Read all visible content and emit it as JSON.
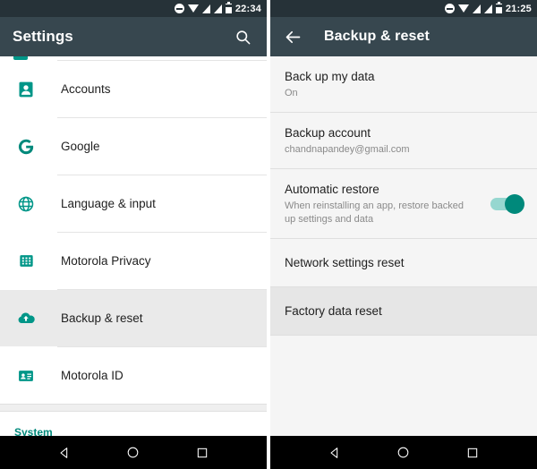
{
  "left_screen": {
    "status_bar": {
      "time": "22:34",
      "icons": [
        "do-not-disturb-icon",
        "wifi-icon",
        "signal-icon",
        "signal-icon",
        "battery-icon"
      ]
    },
    "toolbar": {
      "title": "Settings",
      "search_icon": "search-icon"
    },
    "list_items": [
      {
        "label": "Accounts",
        "icon": "account-icon",
        "selected": false
      },
      {
        "label": "Google",
        "icon": "google-g-icon",
        "selected": false
      },
      {
        "label": "Language & input",
        "icon": "globe-icon",
        "selected": false
      },
      {
        "label": "Motorola Privacy",
        "icon": "privacy-grid-icon",
        "selected": false
      },
      {
        "label": "Backup & reset",
        "icon": "cloud-upload-icon",
        "selected": true
      },
      {
        "label": "Motorola ID",
        "icon": "id-card-icon",
        "selected": false
      }
    ],
    "section_header": "System",
    "nav_bar": {
      "back": "back-triangle-icon",
      "home": "home-circle-icon",
      "recents": "recents-square-icon"
    }
  },
  "right_screen": {
    "status_bar": {
      "time": "21:25",
      "icons": [
        "do-not-disturb-icon",
        "wifi-icon",
        "signal-icon",
        "signal-icon",
        "battery-icon"
      ]
    },
    "toolbar": {
      "back_icon": "back-arrow-icon",
      "title": "Backup & reset"
    },
    "list_items": [
      {
        "title": "Back up my data",
        "subtitle": "On",
        "toggle": null,
        "selected": false
      },
      {
        "title": "Backup account",
        "subtitle": "chandnapandey@gmail.com",
        "toggle": null,
        "selected": false
      },
      {
        "title": "Automatic restore",
        "subtitle": "When reinstalling an app, restore backed up settings and data",
        "toggle": "on",
        "selected": false
      },
      {
        "title": "Network settings reset",
        "subtitle": "",
        "toggle": null,
        "selected": false
      },
      {
        "title": "Factory data reset",
        "subtitle": "",
        "toggle": null,
        "selected": true
      }
    ],
    "nav_bar": {
      "back": "back-triangle-icon",
      "home": "home-circle-icon",
      "recents": "recents-square-icon"
    }
  },
  "colors": {
    "status_bar": "#263238",
    "toolbar": "#37474F",
    "accent_teal": "#00897B",
    "icon_teal": "#009688",
    "selected_row": "#EAEAEA",
    "right_bg": "#F5F5F5",
    "nav_bar": "#000000"
  }
}
